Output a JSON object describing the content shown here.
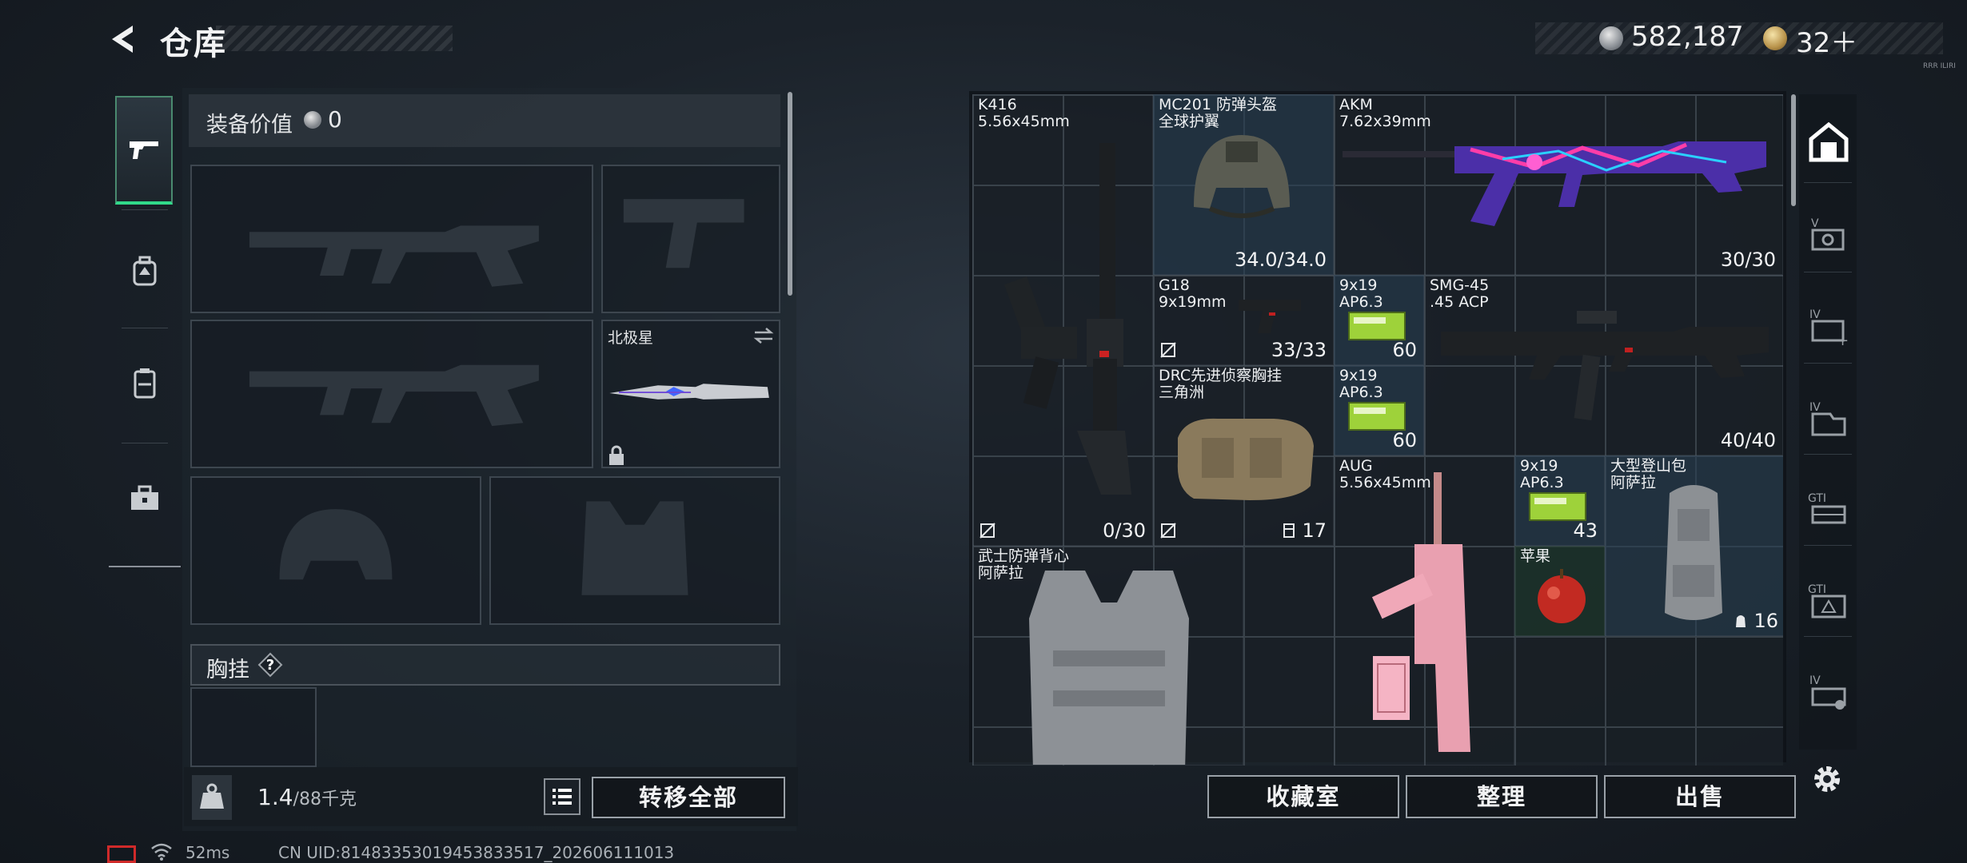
{
  "header": {
    "title": "仓库",
    "back_icon": "back-arrow-icon"
  },
  "currency": {
    "silver": "582,187",
    "gold": "32＋",
    "tag": "RRR ILIRI"
  },
  "left_tabs": [
    "gun-icon",
    "backpack-icon",
    "armor-icon",
    "toolbox-icon"
  ],
  "equipment": {
    "value_label": "装备价值",
    "value": "0",
    "knife_label": "北极星",
    "chest_label": "胸挂",
    "help": "?",
    "weight": "1.4",
    "weight_max": "/88千克",
    "transfer_all": "转移全部"
  },
  "warehouse": {
    "items": [
      {
        "id": "k416",
        "name": "K416\n5.56x45mm",
        "count": "0/30"
      },
      {
        "id": "mc201",
        "name": "MC201 防弹头盔\n全球护翼",
        "count": "34.0/34.0"
      },
      {
        "id": "akm",
        "name": "AKM\n7.62x39mm",
        "count": "30/30"
      },
      {
        "id": "g18",
        "name": "G18\n9x19mm",
        "count": "33/33"
      },
      {
        "id": "ammo1",
        "name": "9x19\nAP6.3",
        "count": "60"
      },
      {
        "id": "smg45",
        "name": "SMG-45\n.45 ACP",
        "count": "40/40"
      },
      {
        "id": "drc",
        "name": "DRC先进侦察胸挂\n三角洲",
        "count": "17"
      },
      {
        "id": "ammo2",
        "name": "9x19\nAP6.3",
        "count": "60"
      },
      {
        "id": "aug",
        "name": "AUG\n5.56x45mm",
        "count": ""
      },
      {
        "id": "ammo3",
        "name": "9x19\nAP6.3",
        "count": "43"
      },
      {
        "id": "backpack",
        "name": "大型登山包\n阿萨拉",
        "count": "16"
      },
      {
        "id": "vest",
        "name": "武士防弹背心\n阿萨拉",
        "count": ""
      },
      {
        "id": "apple",
        "name": "苹果",
        "count": ""
      }
    ],
    "buttons": {
      "collection": "收藏室",
      "sort": "整理",
      "sell": "出售"
    }
  },
  "right_nav": [
    "warehouse-icon",
    "expand-1-icon",
    "expand-2-icon",
    "expand-3-icon",
    "expand-4-icon",
    "expand-5-icon",
    "expand-6-icon",
    "settings-icon"
  ],
  "right_nav_labels": [
    "V",
    "IV",
    "IV",
    "GTI",
    "GTI",
    "IV"
  ],
  "status": {
    "ping": "52ms",
    "uid": "CN UID:814833530194538335​17_202606111013"
  }
}
